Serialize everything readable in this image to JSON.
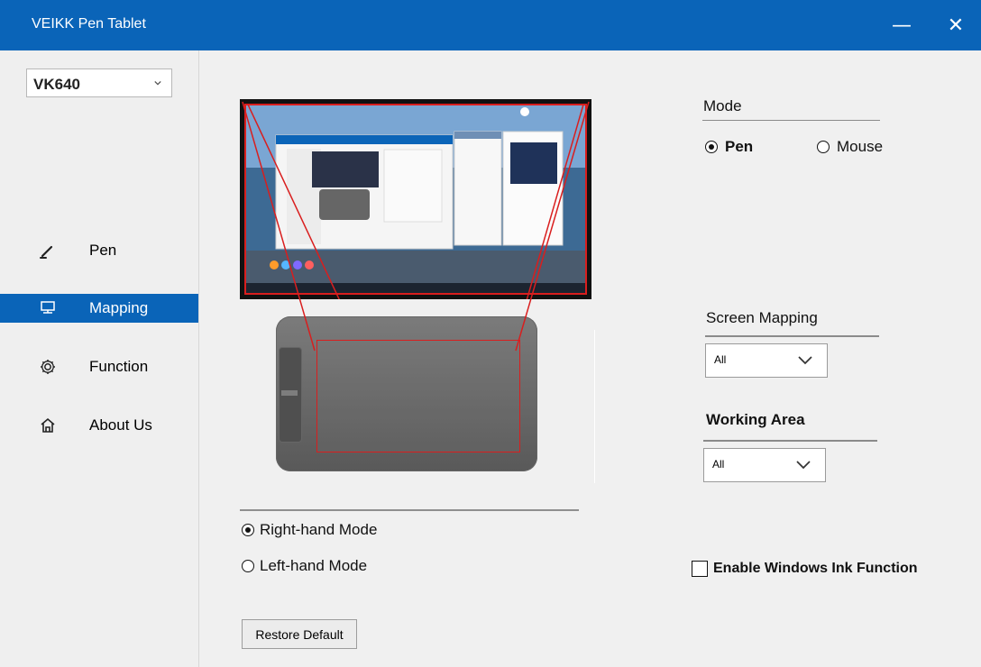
{
  "window": {
    "title": "VEIKK Pen Tablet",
    "minimize_label": "—",
    "close_label": "✕"
  },
  "sidebar": {
    "model": "VK640",
    "items": [
      {
        "label": "Pen",
        "icon": "pen-icon",
        "active": false
      },
      {
        "label": "Mapping",
        "icon": "monitor-icon",
        "active": true
      },
      {
        "label": "Function",
        "icon": "gear-icon",
        "active": false
      },
      {
        "label": "About Us",
        "icon": "home-icon",
        "active": false
      }
    ]
  },
  "main": {
    "mode": {
      "title": "Mode",
      "options": [
        {
          "label": "Pen",
          "checked": true
        },
        {
          "label": "Mouse",
          "checked": false
        }
      ]
    },
    "screen_mapping": {
      "title": "Screen Mapping",
      "value": "All"
    },
    "working_area": {
      "title": "Working Area",
      "value": "All"
    },
    "hand_mode": {
      "options": [
        {
          "label": "Right-hand Mode",
          "checked": true
        },
        {
          "label": "Left-hand Mode",
          "checked": false
        }
      ]
    },
    "windows_ink": {
      "label": "Enable Windows Ink Function",
      "checked": false
    },
    "restore_default": "Restore Default"
  },
  "colors": {
    "accent": "#0a64b8",
    "mapping_highlight": "#d91e1e"
  }
}
